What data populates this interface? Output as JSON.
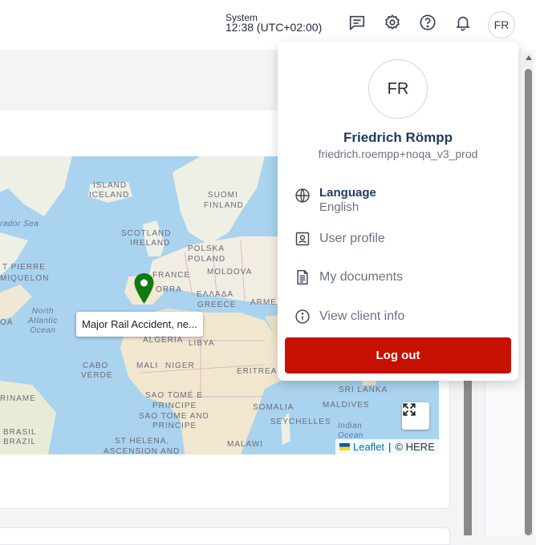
{
  "topbar": {
    "clock_label": "System",
    "clock_time": "12:38 (UTC+02:00)",
    "avatar_initials": "FR",
    "icons": [
      "chat-icon",
      "gear-icon",
      "help-icon",
      "bell-icon"
    ]
  },
  "map": {
    "labels": {
      "island": "ISLAND",
      "iceland": "ICELAND",
      "suomi": "SUOMI",
      "finland": "FINLAND",
      "labrador": "rador Sea",
      "scotland": "SCOTLAND",
      "ireland": "IRELAND",
      "polska": "POLSKA",
      "poland": "POLAND",
      "st_pierre": "T PIERRE",
      "miquelon": "MIQUELON",
      "france": "FRANCE",
      "andorra": "ORRA",
      "moldova": "MOLDOVA",
      "greece_gr": "ΕΛΛΑΔΑ",
      "greece": "GREECE",
      "armenia": "ARME",
      "north_atlantic": "North\nAtlantic\nOcean",
      "oa": "OA",
      "algeria": "ALGERIA",
      "libya": "LIBYA",
      "cabo_verde_1": "CABO",
      "cabo_verde_2": "VERDE",
      "mali": "MALI",
      "niger": "NIGER",
      "eritrea": "ERITREA",
      "sri_lanka": "SRI LANKA",
      "riname": "RINAME",
      "sao_tome_1": "SAO TOMÉ E",
      "sao_tome_2": "PRINCIPE",
      "sao_tome_3": "SAO TOME AND",
      "sao_tome_4": "PRINCIPE",
      "somalia": "SOMALIA",
      "maldives": "MALDIVES",
      "seychelles": "SEYCHELLES",
      "indian_ocean": "Indian\nOcean",
      "brasil": "BRASIL",
      "brazil": "BRAZIL",
      "st_helena_1": "ST HELENA,",
      "st_helena_2": "ASCENSION AND",
      "malawi": "MALAWI"
    },
    "marker_tooltip": "Major Rail Accident, ne...",
    "marker_color": "#0f7a0f",
    "attribution_leaflet": "Leaflet",
    "attribution_sep": "|",
    "attribution_here": "© HERE"
  },
  "menu": {
    "avatar_initials": "FR",
    "user_name": "Friedrich Römpp",
    "email": "friedrich.roempp+noqa_v3_prod",
    "language_title": "Language",
    "language_value": "English",
    "items": [
      {
        "label": "User profile",
        "icon": "user-card-icon"
      },
      {
        "label": "My documents",
        "icon": "document-icon"
      },
      {
        "label": "View client info",
        "icon": "info-icon"
      }
    ],
    "logout_label": "Log out",
    "logout_color": "#c61100"
  }
}
